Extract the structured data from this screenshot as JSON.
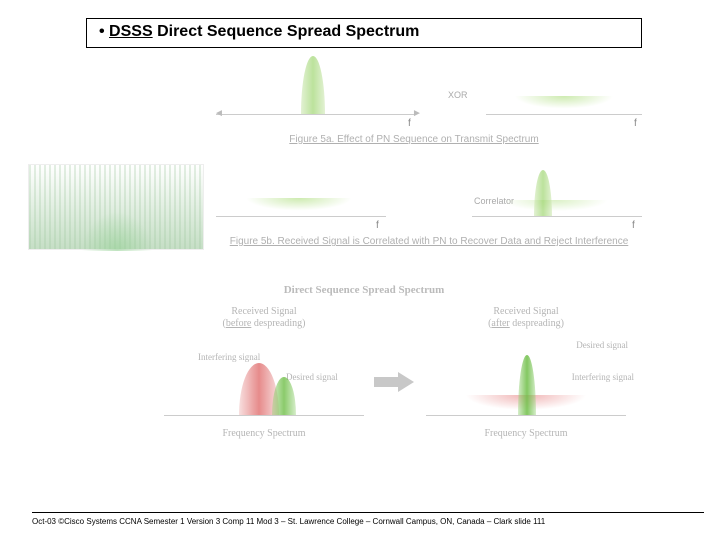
{
  "title": {
    "bullet_prefix": "• ",
    "acronym": "DSSS",
    "rest": " Direct Sequence Spread Spectrum"
  },
  "fig5a": {
    "xor_label": "XOR",
    "f_label_left": "f",
    "f_label_right": "f",
    "caption": "Figure 5a.  Effect of PN Sequence on Transmit Spectrum"
  },
  "fig5b": {
    "correlator_label": "Correlator",
    "f_label_left": "f",
    "f_label_right": "f",
    "caption": "Figure 5b.  Received Signal is Correlated with PN to Recover Data and Reject Interference"
  },
  "ds_header": "Direct Sequence Spread Spectrum",
  "bottom_left": {
    "title_line1": "Received Signal",
    "title_line2_under": "before",
    "title_line2_rest": " despreading)",
    "title_line2_open": "(",
    "interfering_label": "Interfering signal",
    "desired_label": "Desired signal",
    "axis_label": "Frequency Spectrum"
  },
  "bottom_right": {
    "title_line1": "Received Signal",
    "title_line2_open": "(",
    "title_line2_under": "after",
    "title_line2_rest": " despreading)",
    "desired_label": "Desired signal",
    "interfering_label": "Interfering signal",
    "axis_label": "Frequency Spectrum"
  },
  "footer": "Oct-03 ©Cisco Systems CCNA Semester 1 Version 3 Comp 11 Mod 3 – St. Lawrence College – Cornwall Campus, ON, Canada – Clark slide  111"
}
